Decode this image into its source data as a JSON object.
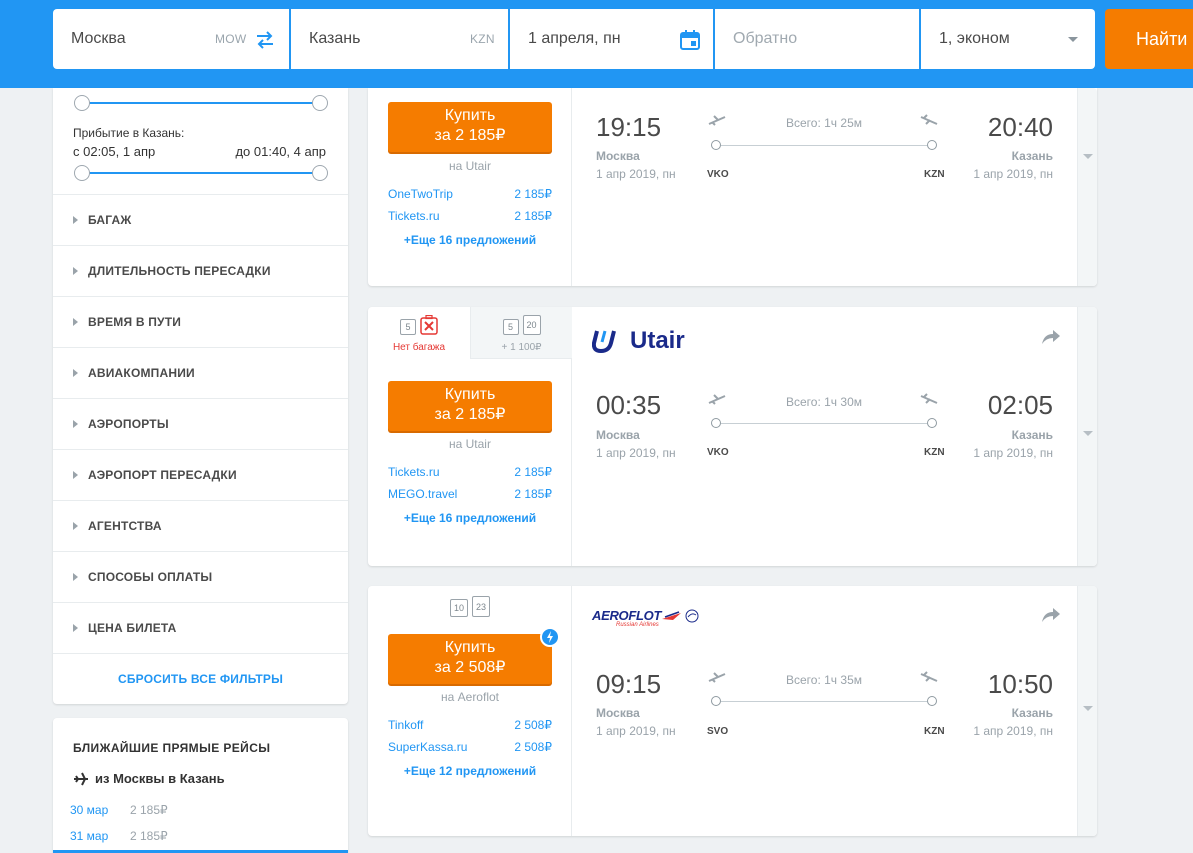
{
  "search": {
    "origin": "Москва",
    "origin_code": "MOW",
    "destination": "Казань",
    "destination_code": "KZN",
    "depart_date": "1 апреля, пн",
    "return_placeholder": "Обратно",
    "passengers": "1, эконом",
    "find_label": "Найти"
  },
  "sidebar": {
    "arrival_label": "Прибытие в Казань:",
    "arrival_from": "с 02:05, 1 апр",
    "arrival_to": "до 01:40, 4 апр",
    "filters": [
      "БАГАЖ",
      "ДЛИТЕЛЬНОСТЬ ПЕРЕСАДКИ",
      "ВРЕМЯ В ПУТИ",
      "АВИАКОМПАНИИ",
      "АЭРОПОРТЫ",
      "АЭРОПОРТ ПЕРЕСАДКИ",
      "АГЕНТСТВА",
      "СПОСОБЫ ОПЛАТЫ",
      "ЦЕНА БИЛЕТА"
    ],
    "reset_label": "СБРОСИТЬ ВСЕ ФИЛЬТРЫ"
  },
  "nearest": {
    "title": "БЛИЖАЙШИЕ ПРЯМЫЕ РЕЙСЫ",
    "route": "из Москвы в Казань",
    "rows": [
      {
        "date": "30 мар",
        "price": "2 185₽"
      },
      {
        "date": "31 мар",
        "price": "2 185₽"
      }
    ]
  },
  "tickets": [
    {
      "buy": "Купить",
      "price": "за 2 185₽",
      "agent": "на Utair",
      "offers": [
        {
          "name": "OneTwoTrip",
          "price": "2 185₽"
        },
        {
          "name": "Tickets.ru",
          "price": "2 185₽"
        }
      ],
      "more": "+Еще 16 предложений",
      "dep_time": "19:15",
      "dep_city": "Москва",
      "dep_date": "1 апр 2019, пн",
      "dep_iata": "VKO",
      "arr_time": "20:40",
      "arr_city": "Казань",
      "arr_date": "1 апр 2019, пн",
      "arr_iata": "KZN",
      "total": "Всего: 1ч 25м"
    },
    {
      "bag_no": "Нет багажа",
      "bag_no_size": "5",
      "bag_extra": "+ 1 100₽",
      "bag_extra_size1": "5",
      "bag_extra_size2": "20",
      "airline": "Utair",
      "buy": "Купить",
      "price": "за 2 185₽",
      "agent": "на Utair",
      "offers": [
        {
          "name": "Tickets.ru",
          "price": "2 185₽"
        },
        {
          "name": "MEGO.travel",
          "price": "2 185₽"
        }
      ],
      "more": "+Еще 16 предложений",
      "dep_time": "00:35",
      "dep_city": "Москва",
      "dep_date": "1 апр 2019, пн",
      "dep_iata": "VKO",
      "arr_time": "02:05",
      "arr_city": "Казань",
      "arr_date": "1 апр 2019, пн",
      "arr_iata": "KZN",
      "total": "Всего: 1ч 30м"
    },
    {
      "bag1": "10",
      "bag2": "23",
      "airline": "AEROFLOT",
      "airline_sub": "Russian Airlines",
      "buy": "Купить",
      "price": "за 2 508₽",
      "agent": "на Aeroflot",
      "offers": [
        {
          "name": "Tinkoff",
          "price": "2 508₽"
        },
        {
          "name": "SuperKassa.ru",
          "price": "2 508₽"
        }
      ],
      "more": "+Еще 12 предложений",
      "dep_time": "09:15",
      "dep_city": "Москва",
      "dep_date": "1 апр 2019, пн",
      "dep_iata": "SVO",
      "arr_time": "10:50",
      "arr_city": "Казань",
      "arr_date": "1 апр 2019, пн",
      "arr_iata": "KZN",
      "total": "Всего: 1ч 35м"
    }
  ],
  "colors": {
    "brand_blue": "#2196f3",
    "accent_orange": "#f57c00"
  }
}
